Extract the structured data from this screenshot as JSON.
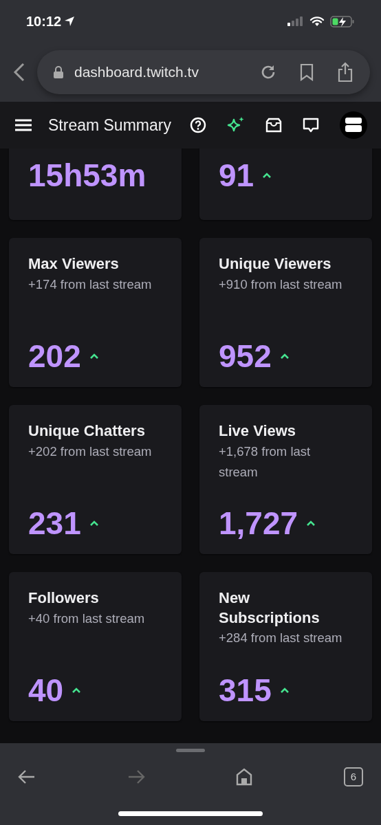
{
  "status_bar": {
    "time": "10:12"
  },
  "browser": {
    "url": "dashboard.twitch.tv",
    "tab_count": "6",
    "forward_disabled": true
  },
  "app_bar": {
    "title": "Stream Summary"
  },
  "stat_cards": [
    {
      "value": "15h53m",
      "trend_up": false
    },
    {
      "value": "91",
      "trend_up": true
    },
    {
      "title": "Max Viewers",
      "subtitle": "+174 from last stream",
      "value": "202",
      "trend_up": true
    },
    {
      "title": "Unique Viewers",
      "subtitle": "+910 from last stream",
      "value": "952",
      "trend_up": true
    },
    {
      "title": "Unique Chatters",
      "subtitle": "+202 from last stream",
      "value": "231",
      "trend_up": true
    },
    {
      "title": "Live Views",
      "subtitle": "+1,678 from last stream",
      "value": "1,727",
      "trend_up": true
    },
    {
      "title": "Followers",
      "subtitle": "+40 from last stream",
      "value": "40",
      "trend_up": true
    },
    {
      "title": "New Subscriptions",
      "subtitle": "+284 from last stream",
      "value": "315",
      "trend_up": true
    }
  ]
}
